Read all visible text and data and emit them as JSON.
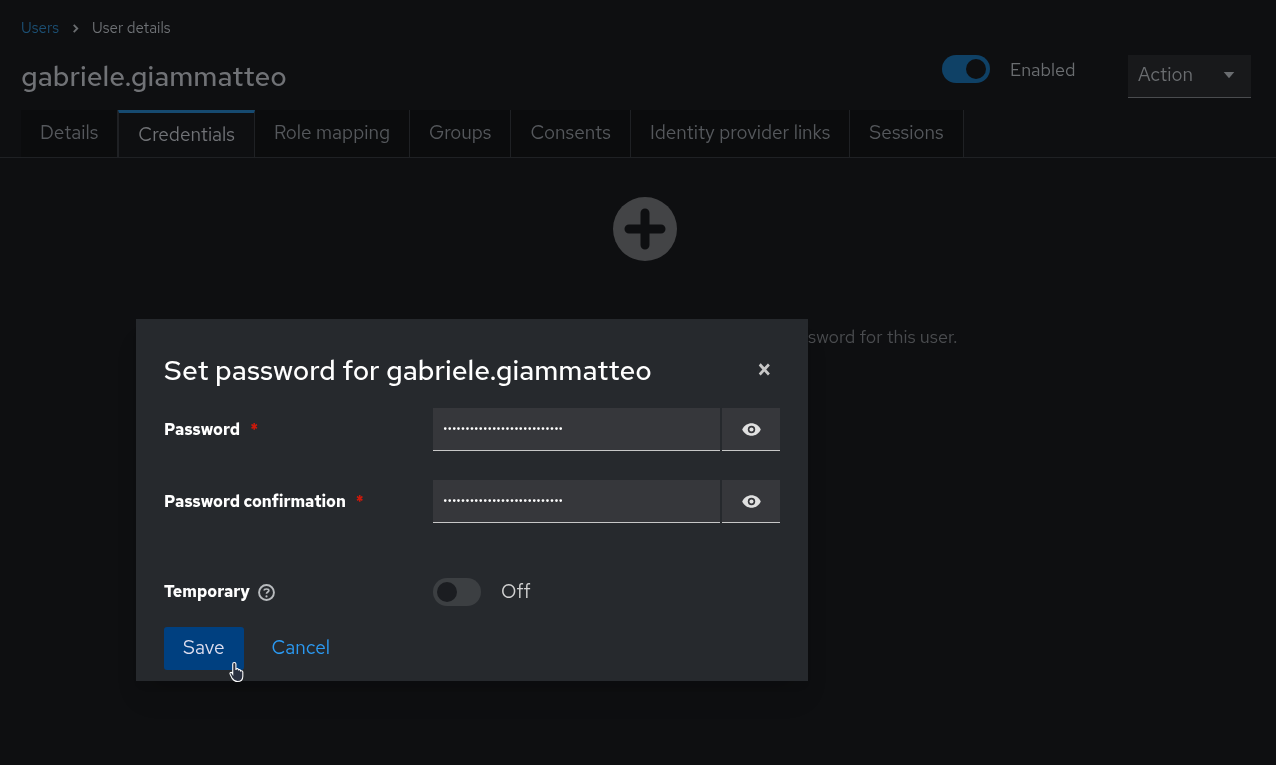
{
  "breadcrumb": [
    "Users",
    "User details"
  ],
  "header": {
    "title": "gabriele.giammatteo",
    "enabled": {
      "on": true,
      "label": "Enabled"
    },
    "action": "Action"
  },
  "tabs": [
    {
      "label": "Details",
      "selected": false
    },
    {
      "label": "Credentials",
      "selected": true
    },
    {
      "label": "Role mapping",
      "selected": false
    },
    {
      "label": "Groups",
      "selected": false
    },
    {
      "label": "Consents",
      "selected": false
    },
    {
      "label": "Identity provider links",
      "selected": false
    },
    {
      "label": "Sessions",
      "selected": false
    }
  ],
  "empty_state": {
    "description": "sword for this user."
  },
  "dialog": {
    "title": "Set password for gabriele.giammatteo",
    "close": "×",
    "fields": [
      {
        "kind": "password",
        "label": "Password",
        "required_mark": "*",
        "value": "•••••••••••••••••••••••••••"
      },
      {
        "kind": "password",
        "label": "Password confirmation",
        "required_mark": "*",
        "value": "•••••••••••••••••••••••••••"
      },
      {
        "kind": "switch",
        "label": "Temporary",
        "help": true,
        "on": false,
        "state_label": "Off"
      }
    ],
    "buttons": [
      {
        "kind": "primary",
        "label": "Save"
      },
      {
        "kind": "link",
        "label": "Cancel"
      }
    ]
  }
}
